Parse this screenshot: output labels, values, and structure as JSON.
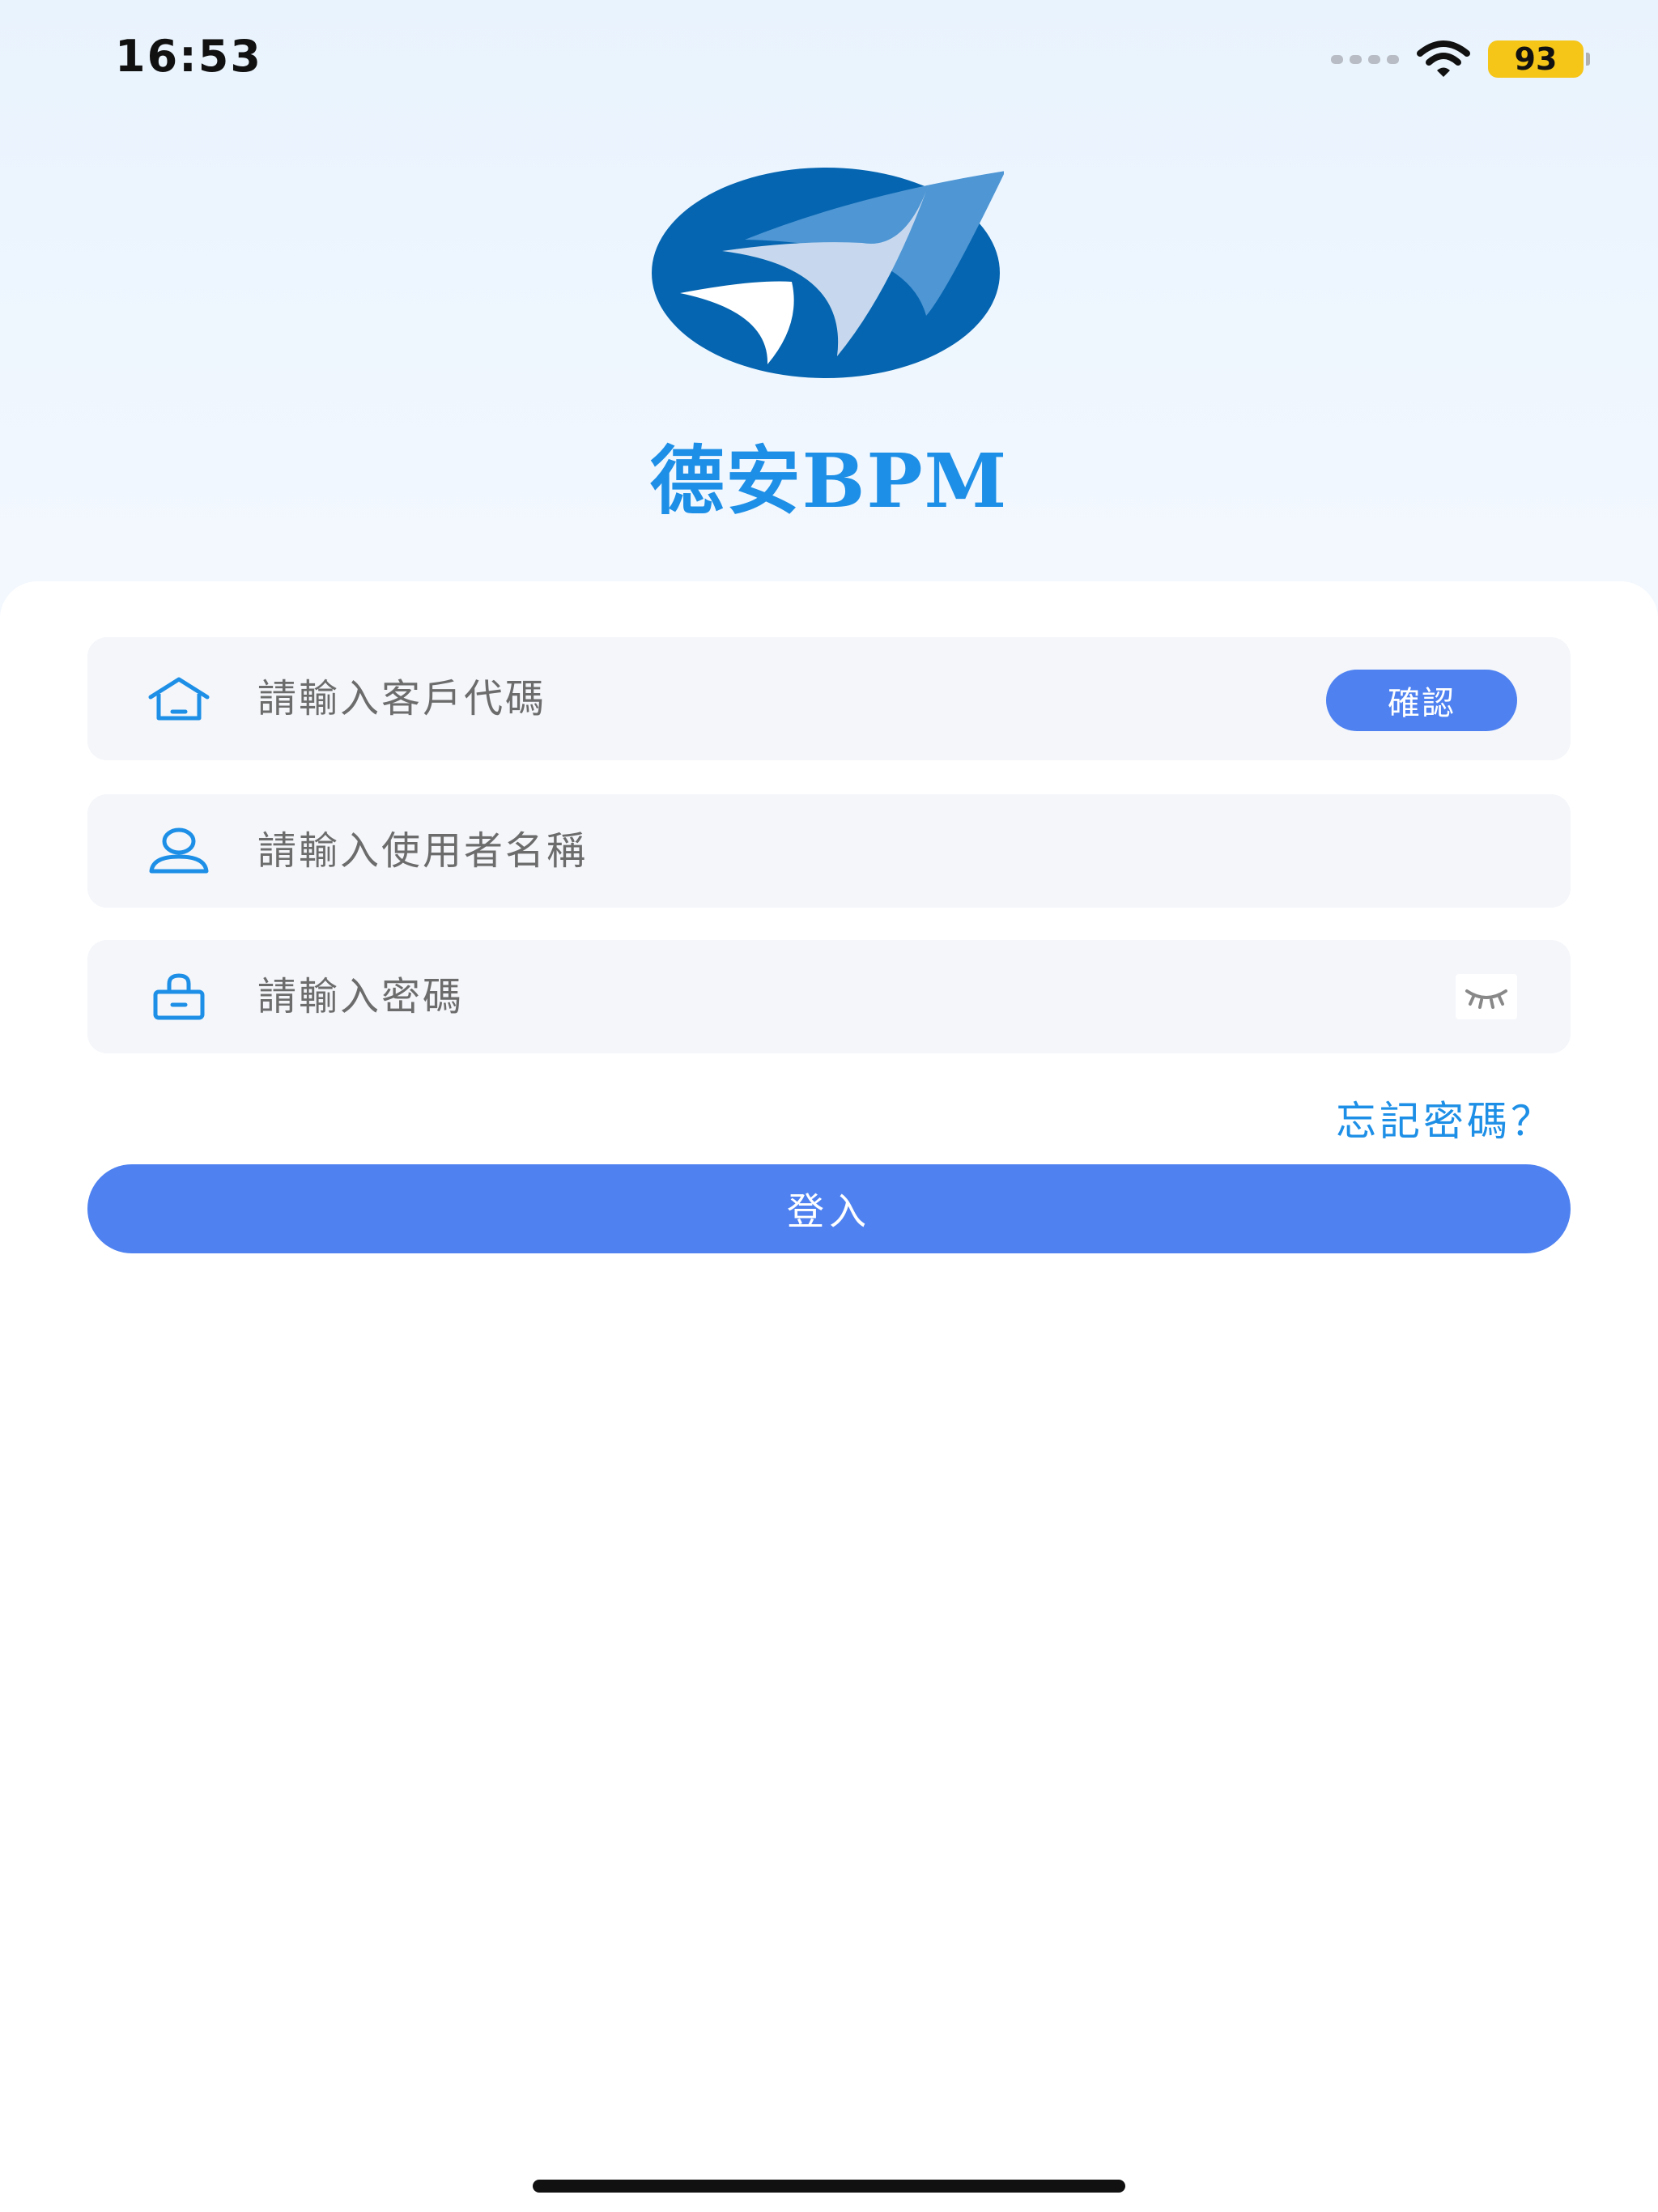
{
  "status_bar": {
    "time": "16:53",
    "battery": "93",
    "icons": [
      "cellular-signal-icon",
      "wifi-icon",
      "battery-icon"
    ]
  },
  "brand": {
    "name": "德安BPM",
    "logo_icon": "paper-plane-logo",
    "colors": {
      "primary": "#1e8fe6",
      "logo_dark": "#0565b0",
      "logo_light": "#4e96d4"
    }
  },
  "form": {
    "customer_code": {
      "placeholder": "請輸入客戶代碼",
      "value": "",
      "icon": "home-icon",
      "confirm_label": "確認"
    },
    "username": {
      "placeholder": "請輸入使用者名稱",
      "value": "",
      "icon": "user-icon"
    },
    "password": {
      "placeholder": "請輸入密碼",
      "value": "",
      "icon": "lock-icon",
      "toggle_icon": "eye-closed-icon"
    },
    "forgot_label": "忘記密碼？",
    "login_label": "登入",
    "accent": "#4f82f0"
  }
}
